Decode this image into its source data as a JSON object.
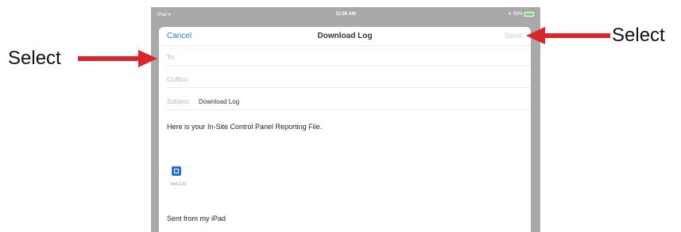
{
  "status_bar": {
    "device": "iPad",
    "time": "11:36 AM",
    "battery_text": "99%",
    "battery_level": 0.99
  },
  "compose": {
    "cancel_label": "Cancel",
    "title": "Download Log",
    "send_label": "Send",
    "to_label": "To:",
    "cc_bcc_label": "Cc/Bcc:",
    "subject_label": "Subject:",
    "subject_value": "Download Log",
    "body": "Here is your In-Site Control Panel Reporting File.",
    "attachment_name": "Test 3.21",
    "signature": "Sent from my iPad"
  },
  "annotations": {
    "left_label": "Select",
    "right_label": "Select"
  },
  "colors": {
    "accent": "#3478d4",
    "arrow": "#d7262c",
    "frame": "#a9a9a9"
  }
}
